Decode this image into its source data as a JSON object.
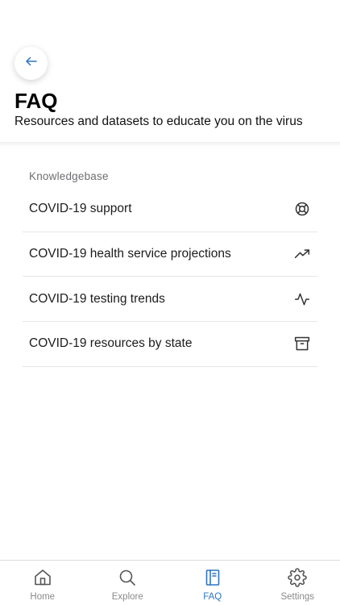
{
  "header": {
    "back_icon": "arrow-left-icon",
    "title": "FAQ",
    "subtitle": "Resources and datasets to educate you on the virus"
  },
  "knowledgebase": {
    "section_label": "Knowledgebase",
    "items": [
      {
        "label": "COVID-19 support",
        "icon": "lifebuoy-icon"
      },
      {
        "label": "COVID-19 health service projections",
        "icon": "trending-up-icon"
      },
      {
        "label": "COVID-19 testing trends",
        "icon": "activity-icon"
      },
      {
        "label": "COVID-19 resources by state",
        "icon": "archive-icon"
      }
    ]
  },
  "tabbar": {
    "active_color": "#2f74c0",
    "inactive_color": "#8a8a8e",
    "tabs": [
      {
        "label": "Home",
        "icon": "home-icon",
        "active": false
      },
      {
        "label": "Explore",
        "icon": "search-icon",
        "active": false
      },
      {
        "label": "FAQ",
        "icon": "book-icon",
        "active": true
      },
      {
        "label": "Settings",
        "icon": "gear-icon",
        "active": false
      }
    ]
  }
}
